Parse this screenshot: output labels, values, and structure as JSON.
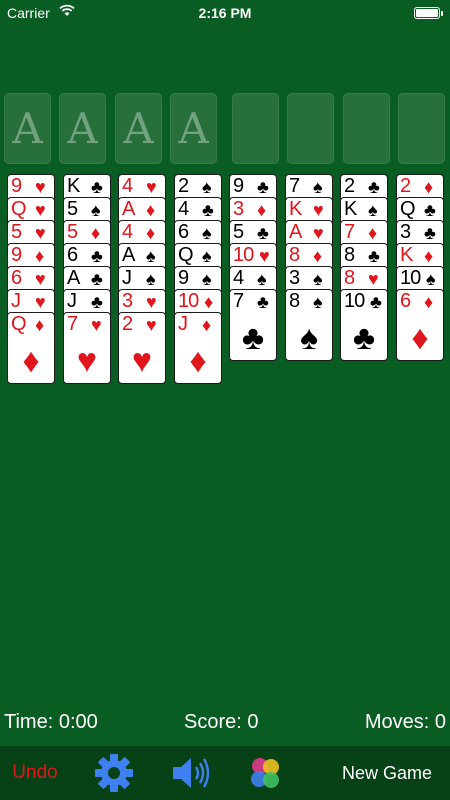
{
  "status": {
    "carrier": "Carrier",
    "time": "2:16 PM"
  },
  "foundations": [
    {
      "label": "A"
    },
    {
      "label": "A"
    },
    {
      "label": "A"
    },
    {
      "label": "A"
    }
  ],
  "freecells": [
    {},
    {},
    {},
    {}
  ],
  "columns": [
    [
      {
        "rank": "9",
        "suit": "♥",
        "color": "red"
      },
      {
        "rank": "Q",
        "suit": "♥",
        "color": "red"
      },
      {
        "rank": "5",
        "suit": "♥",
        "color": "red"
      },
      {
        "rank": "9",
        "suit": "♦",
        "color": "red"
      },
      {
        "rank": "6",
        "suit": "♥",
        "color": "red"
      },
      {
        "rank": "J",
        "suit": "♥",
        "color": "red"
      },
      {
        "rank": "Q",
        "suit": "♦",
        "color": "red"
      }
    ],
    [
      {
        "rank": "K",
        "suit": "♣",
        "color": "black"
      },
      {
        "rank": "5",
        "suit": "♠",
        "color": "black"
      },
      {
        "rank": "5",
        "suit": "♦",
        "color": "red"
      },
      {
        "rank": "6",
        "suit": "♣",
        "color": "black"
      },
      {
        "rank": "A",
        "suit": "♣",
        "color": "black"
      },
      {
        "rank": "J",
        "suit": "♣",
        "color": "black"
      },
      {
        "rank": "7",
        "suit": "♥",
        "color": "red"
      }
    ],
    [
      {
        "rank": "4",
        "suit": "♥",
        "color": "red"
      },
      {
        "rank": "A",
        "suit": "♦",
        "color": "red"
      },
      {
        "rank": "4",
        "suit": "♦",
        "color": "red"
      },
      {
        "rank": "A",
        "suit": "♠",
        "color": "black"
      },
      {
        "rank": "J",
        "suit": "♠",
        "color": "black"
      },
      {
        "rank": "3",
        "suit": "♥",
        "color": "red"
      },
      {
        "rank": "2",
        "suit": "♥",
        "color": "red"
      }
    ],
    [
      {
        "rank": "2",
        "suit": "♠",
        "color": "black"
      },
      {
        "rank": "4",
        "suit": "♣",
        "color": "black"
      },
      {
        "rank": "6",
        "suit": "♠",
        "color": "black"
      },
      {
        "rank": "Q",
        "suit": "♠",
        "color": "black"
      },
      {
        "rank": "9",
        "suit": "♠",
        "color": "black"
      },
      {
        "rank": "10",
        "suit": "♦",
        "color": "red"
      },
      {
        "rank": "J",
        "suit": "♦",
        "color": "red"
      }
    ],
    [
      {
        "rank": "9",
        "suit": "♣",
        "color": "black"
      },
      {
        "rank": "3",
        "suit": "♦",
        "color": "red"
      },
      {
        "rank": "5",
        "suit": "♣",
        "color": "black"
      },
      {
        "rank": "10",
        "suit": "♥",
        "color": "red"
      },
      {
        "rank": "4",
        "suit": "♠",
        "color": "black"
      },
      {
        "rank": "7",
        "suit": "♣",
        "color": "black"
      }
    ],
    [
      {
        "rank": "7",
        "suit": "♠",
        "color": "black"
      },
      {
        "rank": "K",
        "suit": "♥",
        "color": "red"
      },
      {
        "rank": "A",
        "suit": "♥",
        "color": "red"
      },
      {
        "rank": "8",
        "suit": "♦",
        "color": "red"
      },
      {
        "rank": "3",
        "suit": "♠",
        "color": "black"
      },
      {
        "rank": "8",
        "suit": "♠",
        "color": "black"
      }
    ],
    [
      {
        "rank": "2",
        "suit": "♣",
        "color": "black"
      },
      {
        "rank": "K",
        "suit": "♠",
        "color": "black"
      },
      {
        "rank": "7",
        "suit": "♦",
        "color": "red"
      },
      {
        "rank": "8",
        "suit": "♣",
        "color": "black"
      },
      {
        "rank": "8",
        "suit": "♥",
        "color": "red"
      },
      {
        "rank": "10",
        "suit": "♣",
        "color": "black"
      }
    ],
    [
      {
        "rank": "2",
        "suit": "♦",
        "color": "red"
      },
      {
        "rank": "Q",
        "suit": "♣",
        "color": "black"
      },
      {
        "rank": "3",
        "suit": "♣",
        "color": "black"
      },
      {
        "rank": "K",
        "suit": "♦",
        "color": "red"
      },
      {
        "rank": "10",
        "suit": "♠",
        "color": "black"
      },
      {
        "rank": "6",
        "suit": "♦",
        "color": "red"
      }
    ]
  ],
  "stats": {
    "time": "Time: 0:00",
    "score": "Score: 0",
    "moves": "Moves: 0"
  },
  "toolbar": {
    "undo": "Undo",
    "settings_icon": "gear-icon",
    "sound_icon": "speaker-icon",
    "gamecenter_icon": "game-center-icon",
    "new_game": "New Game"
  },
  "colors": {
    "felt": "#0a5d22",
    "toolbar": "#074116",
    "red": "#e0161c",
    "undo": "#e0161c",
    "icon_blue": "#3f80f0"
  }
}
